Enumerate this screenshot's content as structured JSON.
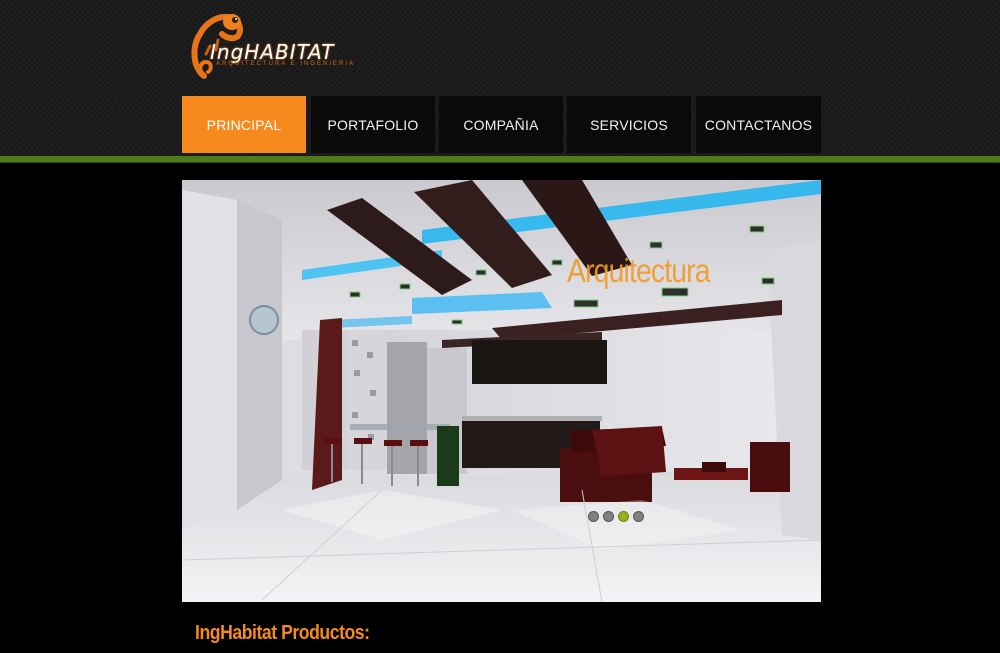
{
  "brand": {
    "logo_name": "IngHABITAT",
    "logo_tagline": "ARQUITECTURA E INGENIERIA",
    "mascot_icon": "chameleon-icon",
    "accent": "#f78a1d",
    "bar_green": "#4e7a1c"
  },
  "nav": {
    "items": [
      {
        "label": "PRINCIPAL",
        "active": true
      },
      {
        "label": "PORTAFOLIO",
        "active": false
      },
      {
        "label": "COMPAÑIA",
        "active": false
      },
      {
        "label": "SERVICIOS",
        "active": false
      },
      {
        "label": "CONTACTANOS",
        "active": false
      }
    ]
  },
  "slider": {
    "caption": "Arquitectura",
    "slide_count": 4,
    "active_slide": 3
  },
  "products": {
    "title": "IngHabitat Productos:"
  }
}
